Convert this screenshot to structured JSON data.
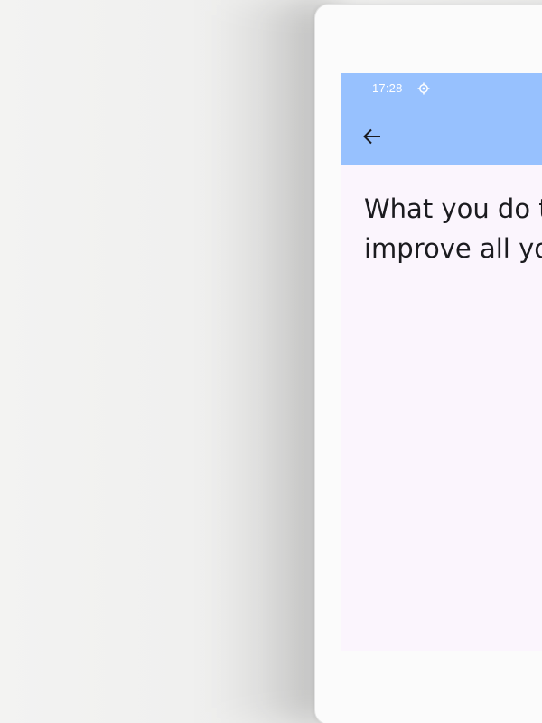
{
  "status_bar": {
    "time": "17:28",
    "icon": "settings-gear-icon"
  },
  "header": {
    "back_icon": "arrow-back-icon",
    "background_color": "#97c1fe"
  },
  "content": {
    "line1": "What you do t",
    "line2": "improve all yo"
  },
  "colors": {
    "screen_background": "#fbf5fd",
    "text": "#1b1b1f"
  }
}
